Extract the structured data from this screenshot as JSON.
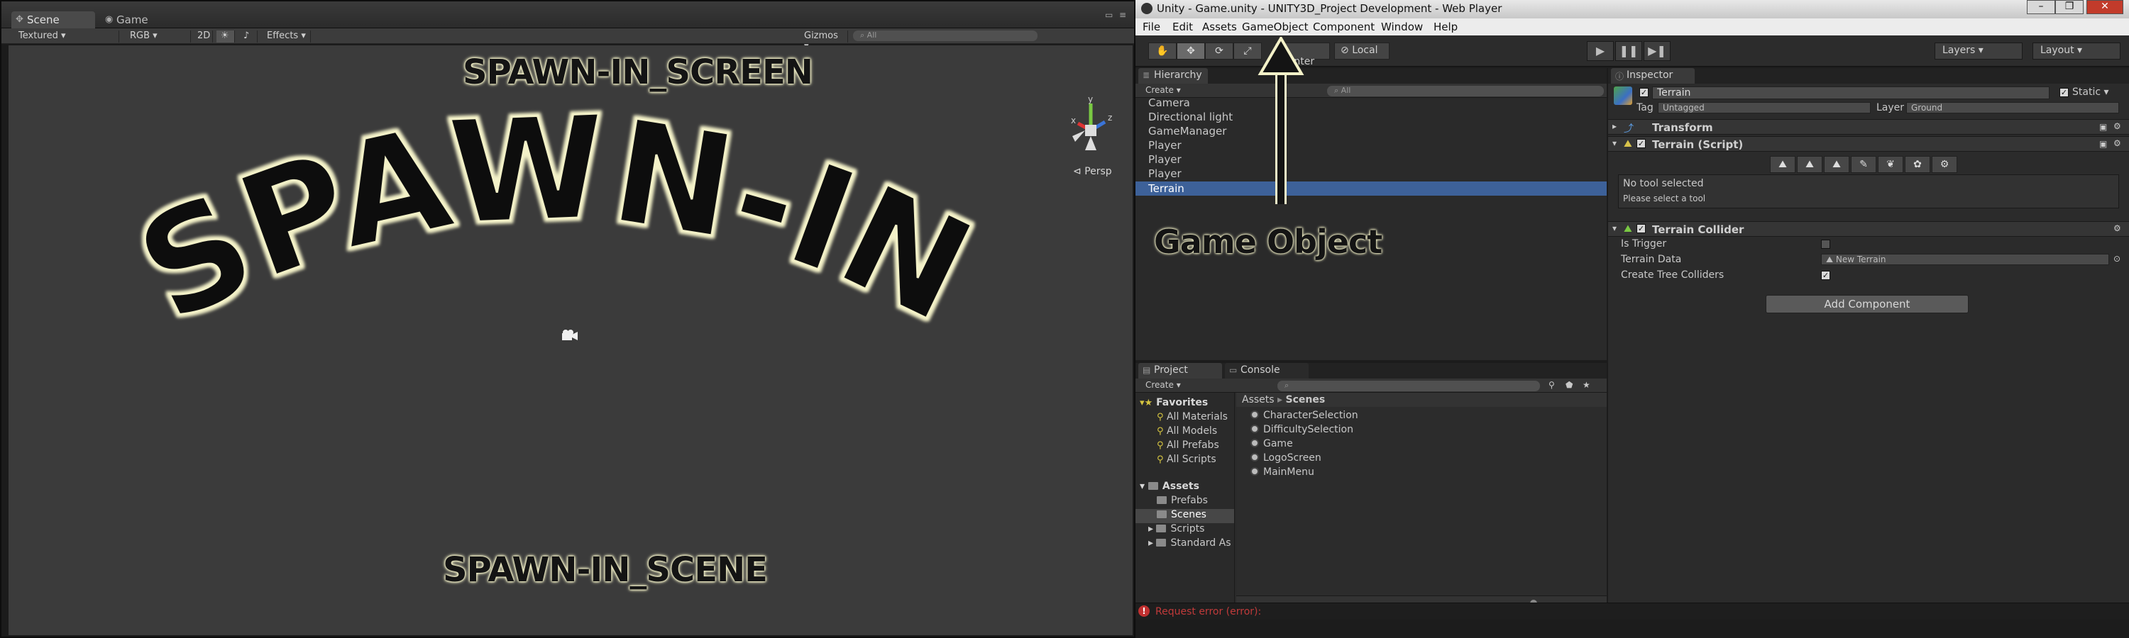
{
  "scene_window": {
    "tabs": [
      {
        "label": "Scene",
        "icon": "scene-icon"
      },
      {
        "label": "Game",
        "icon": "game-icon"
      }
    ],
    "toolbar": {
      "draw_mode": "Textured",
      "render_mode": "RGB",
      "mode_2d": "2D",
      "effects": "Effects",
      "gizmos": "Gizmos",
      "search_placeholder": "All"
    },
    "persp_label": "Persp",
    "overlay_top": "SPAWN-IN_SCREEN",
    "overlay_arc": "SPAWN-IN",
    "overlay_bottom": "SPAWN-IN_SCENE"
  },
  "editor": {
    "title": "Unity - Game.unity - UNITY3D_Project Development - Web Player",
    "menu": [
      "File",
      "Edit",
      "Assets",
      "GameObject",
      "Component",
      "Window",
      "Help"
    ],
    "toolbar": {
      "pivot_mode": "Center",
      "pivot_rotation": "Local",
      "layers": "Layers",
      "layout": "Layout"
    },
    "hierarchy": {
      "tab": "Hierarchy",
      "create": "Create",
      "search_placeholder": "All",
      "items": [
        "Camera",
        "Directional light",
        "GameManager",
        "Player",
        "Player",
        "Player",
        "Terrain"
      ],
      "selected": "Terrain"
    },
    "project": {
      "tabs": [
        "Project",
        "Console"
      ],
      "create": "Create",
      "favorites_label": "Favorites",
      "favorites": [
        "All Materials",
        "All Models",
        "All Prefabs",
        "All Scripts"
      ],
      "assets_label": "Assets",
      "folders": [
        "Prefabs",
        "Scenes",
        "Scripts",
        "Standard As"
      ],
      "selected_folder": "Scenes",
      "breadcrumb": [
        "Assets",
        "Scenes"
      ],
      "scenes": [
        "CharacterSelection",
        "DifficultySelection",
        "Game",
        "LogoScreen",
        "MainMenu"
      ]
    },
    "inspector": {
      "tab": "Inspector",
      "object_name": "Terrain",
      "static_label": "Static",
      "tag_label": "Tag",
      "tag_value": "Untagged",
      "layer_label": "Layer",
      "layer_value": "Ground",
      "transform_title": "Transform",
      "terrain_script_title": "Terrain (Script)",
      "no_tool": "No tool selected",
      "select_tool": "Please select a tool",
      "collider_title": "Terrain Collider",
      "is_trigger_label": "Is Trigger",
      "terrain_data_label": "Terrain Data",
      "terrain_data_value": "New Terrain",
      "create_tree_label": "Create Tree Colliders",
      "add_component": "Add Component"
    },
    "status_error": "Request error (error):",
    "annotation": "Game Object"
  }
}
